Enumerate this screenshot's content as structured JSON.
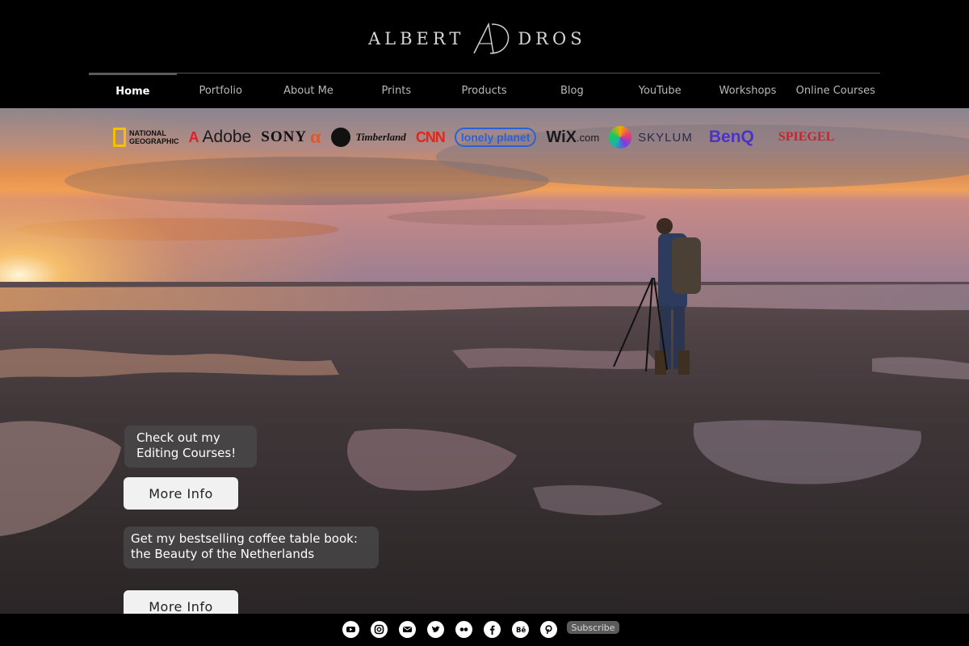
{
  "brand": {
    "first": "ALBERT",
    "second": "DROS"
  },
  "nav": {
    "items": [
      {
        "label": "Home",
        "active": true
      },
      {
        "label": "Portfolio"
      },
      {
        "label": "About Me"
      },
      {
        "label": "Prints"
      },
      {
        "label": "Products"
      },
      {
        "label": "Blog"
      },
      {
        "label": "YouTube"
      },
      {
        "label": "Workshops"
      },
      {
        "label": "Online Courses"
      }
    ]
  },
  "partners": {
    "natgeo_1": "NATIONAL",
    "natgeo_2": "GEOGRAPHIC",
    "adobe": "Adobe",
    "sony": "SONY",
    "sony_alpha": "α",
    "timberland": "Timberland",
    "cnn": "CNN",
    "lonely": "lonely planet",
    "wix": "WiX",
    "wix_domain": ".com",
    "skylum": "SKYLUM",
    "benq": "BenQ",
    "spiegel": "SPIEGEL"
  },
  "promos": [
    {
      "text_line1": "Check out my",
      "text_line2": "Editing Courses!",
      "button": "More Info"
    },
    {
      "text_line1": "Get my bestselling coffee table book:",
      "text_line2": "the Beauty of the Netherlands",
      "button": "More Info"
    }
  ],
  "footer": {
    "social_icons": [
      "youtube-icon",
      "instagram-icon",
      "email-icon",
      "twitter-icon",
      "flickr-icon",
      "facebook-icon",
      "behance-icon",
      "pinterest-icon"
    ],
    "subscribe": "Subscribe"
  },
  "colors": {
    "header_bg": "#000000",
    "nav_inactive": "#b9b9b9",
    "promo_bg": "rgba(75,75,75,0.72)",
    "button_bg": "#f1f1f1"
  }
}
